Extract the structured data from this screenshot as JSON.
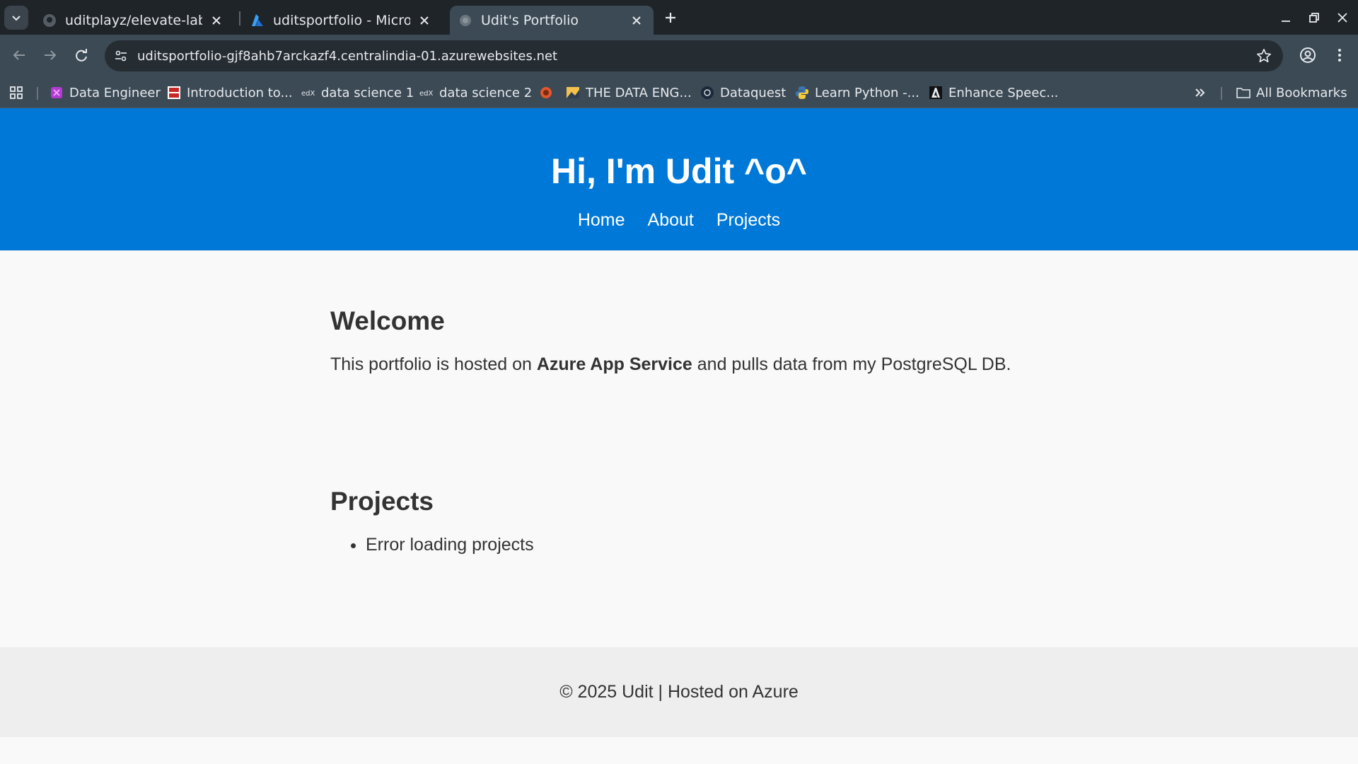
{
  "browser": {
    "tabs": [
      {
        "title": "uditplayz/elevate-labs_U",
        "icon": "github-icon"
      },
      {
        "title": "uditsportfolio - Microsof",
        "icon": "azure-icon"
      },
      {
        "title": "Udit's Portfolio",
        "icon": "globe-icon",
        "active": true
      }
    ],
    "url": "uditsportfolio-gjf8ahb7arckazf4.centralindia-01.azurewebsites.net",
    "bookmarks": [
      {
        "label": "Data Engineer",
        "icon": "datacamp-icon"
      },
      {
        "label": "Introduction to...",
        "icon": "mit-ocw-icon"
      },
      {
        "label": "data science 1",
        "icon": "edx-icon"
      },
      {
        "label": "data science 2",
        "icon": "edx-icon"
      },
      {
        "label": "",
        "icon": "orange-circle-icon"
      },
      {
        "label": "THE DATA ENG...",
        "icon": "image-icon"
      },
      {
        "label": "Dataquest",
        "icon": "dataquest-icon"
      },
      {
        "label": "Learn Python -...",
        "icon": "python-icon"
      },
      {
        "label": "Enhance Speec...",
        "icon": "adobe-icon"
      }
    ],
    "all_bookmarks_label": "All Bookmarks"
  },
  "header": {
    "title": "Hi, I'm Udit ^o^",
    "nav": [
      "Home",
      "About",
      "Projects"
    ]
  },
  "welcome": {
    "heading": "Welcome",
    "text_before": "This portfolio is hosted on ",
    "text_bold": "Azure App Service",
    "text_after": " and pulls data from my PostgreSQL DB."
  },
  "projects": {
    "heading": "Projects",
    "items": [
      "Error loading projects"
    ]
  },
  "footer": {
    "text": "© 2025 Udit | Hosted on Azure"
  },
  "colors": {
    "header_bg": "#0078d7",
    "footer_bg": "#eeeeee",
    "page_bg": "#f9f9f9"
  }
}
